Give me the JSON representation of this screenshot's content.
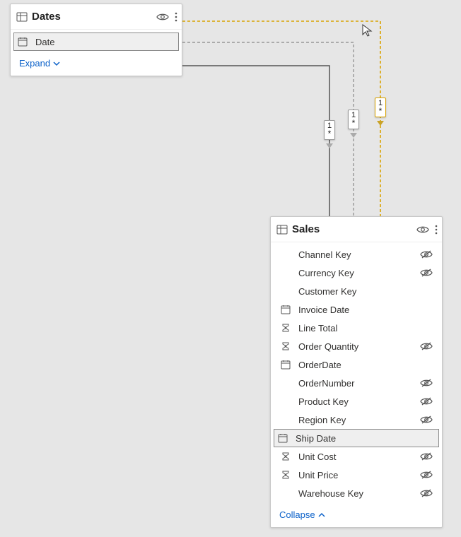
{
  "datesCard": {
    "title": "Dates",
    "fields": [
      {
        "label": "Date",
        "icon": "calendar",
        "hidden": false,
        "selected": true
      }
    ],
    "toggle": "Expand"
  },
  "salesCard": {
    "title": "Sales",
    "fields": [
      {
        "label": "Channel Key",
        "icon": "",
        "hidden": true,
        "selected": false
      },
      {
        "label": "Currency Key",
        "icon": "",
        "hidden": true,
        "selected": false
      },
      {
        "label": "Customer Key",
        "icon": "",
        "hidden": false,
        "selected": false
      },
      {
        "label": "Invoice Date",
        "icon": "calendar",
        "hidden": false,
        "selected": false
      },
      {
        "label": "Line Total",
        "icon": "sigma",
        "hidden": false,
        "selected": false
      },
      {
        "label": "Order Quantity",
        "icon": "sigma",
        "hidden": true,
        "selected": false
      },
      {
        "label": "OrderDate",
        "icon": "calendar",
        "hidden": false,
        "selected": false
      },
      {
        "label": "OrderNumber",
        "icon": "",
        "hidden": true,
        "selected": false
      },
      {
        "label": "Product Key",
        "icon": "",
        "hidden": true,
        "selected": false
      },
      {
        "label": "Region Key",
        "icon": "",
        "hidden": true,
        "selected": false
      },
      {
        "label": "Ship Date",
        "icon": "calendar",
        "hidden": false,
        "selected": true
      },
      {
        "label": "Unit Cost",
        "icon": "sigma",
        "hidden": true,
        "selected": false
      },
      {
        "label": "Unit Price",
        "icon": "sigma",
        "hidden": true,
        "selected": false
      },
      {
        "label": "Warehouse Key",
        "icon": "",
        "hidden": true,
        "selected": false
      }
    ],
    "toggle": "Collapse"
  },
  "relationships": [
    {
      "one": "1",
      "many": "*",
      "highlight": false
    },
    {
      "one": "1",
      "many": "*",
      "highlight": false
    },
    {
      "one": "1",
      "many": "*",
      "highlight": true
    }
  ]
}
